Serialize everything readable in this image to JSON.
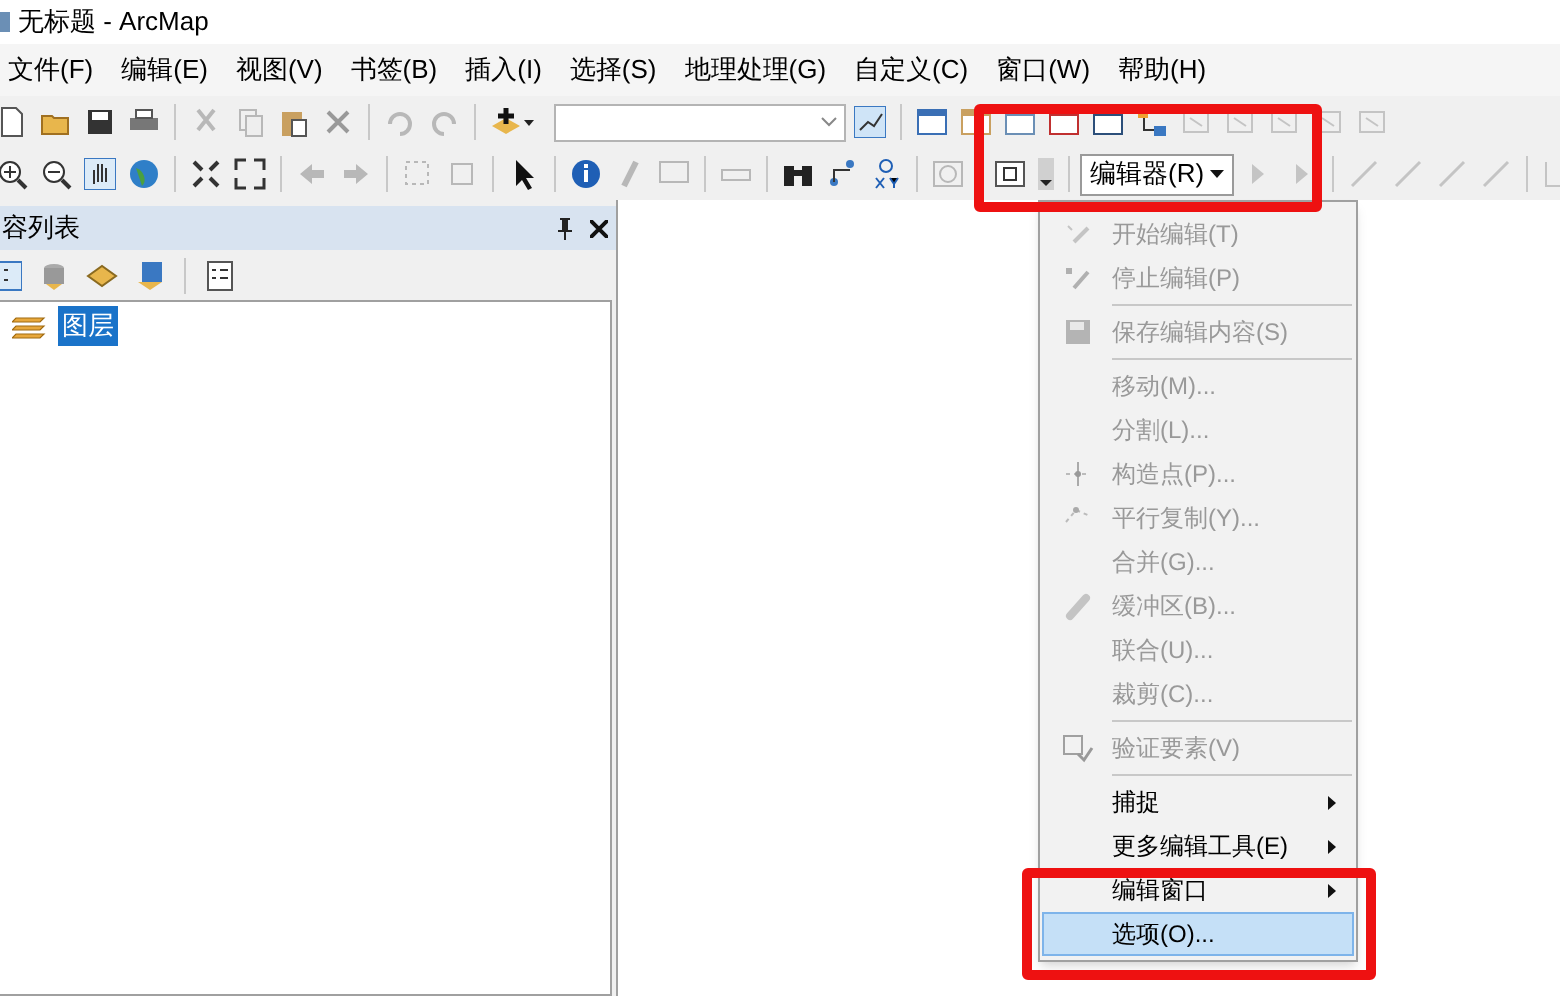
{
  "window": {
    "title": "无标题 - ArcMap"
  },
  "menubar": [
    "文件(F)",
    "编辑(E)",
    "视图(V)",
    "书签(B)",
    "插入(I)",
    "选择(S)",
    "地理处理(G)",
    "自定义(C)",
    "窗口(W)",
    "帮助(H)"
  ],
  "editor_toolbar": {
    "button": "编辑器(R)"
  },
  "toc": {
    "title": "容列表",
    "layers": [
      {
        "label": "图层",
        "selected": true
      }
    ]
  },
  "editor_menu": {
    "items": [
      {
        "kind": "item",
        "label": "开始编辑(T)",
        "disabled": true,
        "selected": false
      },
      {
        "kind": "item",
        "label": "停止编辑(P)",
        "disabled": true,
        "selected": false
      },
      {
        "kind": "separator"
      },
      {
        "kind": "item",
        "label": "保存编辑内容(S)",
        "disabled": true,
        "selected": false
      },
      {
        "kind": "separator"
      },
      {
        "kind": "item",
        "label": "移动(M)...",
        "disabled": true,
        "selected": false
      },
      {
        "kind": "item",
        "label": "分割(L)...",
        "disabled": true,
        "selected": false
      },
      {
        "kind": "item",
        "label": "构造点(P)...",
        "disabled": true,
        "selected": false
      },
      {
        "kind": "item",
        "label": "平行复制(Y)...",
        "disabled": true,
        "selected": false
      },
      {
        "kind": "item",
        "label": "合并(G)...",
        "disabled": true,
        "selected": false
      },
      {
        "kind": "item",
        "label": "缓冲区(B)...",
        "disabled": true,
        "selected": false
      },
      {
        "kind": "item",
        "label": "联合(U)...",
        "disabled": true,
        "selected": false
      },
      {
        "kind": "item",
        "label": "裁剪(C)...",
        "disabled": true,
        "selected": false
      },
      {
        "kind": "separator"
      },
      {
        "kind": "item",
        "label": "验证要素(V)",
        "disabled": true,
        "selected": false
      },
      {
        "kind": "separator"
      },
      {
        "kind": "submenu",
        "label": "捕捉",
        "disabled": false,
        "selected": false
      },
      {
        "kind": "submenu",
        "label": "更多编辑工具(E)",
        "disabled": false,
        "selected": false
      },
      {
        "kind": "submenu",
        "label": "编辑窗口",
        "disabled": false,
        "selected": false
      },
      {
        "kind": "item",
        "label": "选项(O)...",
        "disabled": false,
        "selected": true
      }
    ]
  }
}
